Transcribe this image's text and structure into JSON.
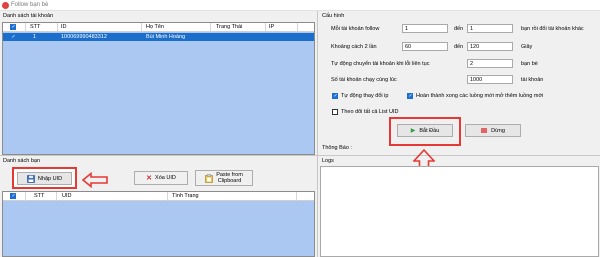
{
  "window": {
    "title": "Follow bạn bè"
  },
  "left_top": {
    "group_label": "Danh sách tài khoản",
    "columns": [
      "STT",
      "ID",
      "Họ Tên",
      "Trang Thái",
      "IP"
    ],
    "rows": [
      {
        "checked": true,
        "stt": "1",
        "id": "100069990483312",
        "name": "Bùi Minh Hoàng",
        "status": "",
        "ip": ""
      }
    ]
  },
  "config": {
    "group_label": "Cấu hình",
    "follow_per_account": {
      "label": "Mỗi tài khoản follow",
      "from": "1",
      "den": "đến",
      "to": "1",
      "suffix": "bạn rồi đổi tài khoản khác"
    },
    "interval": {
      "label": "Khoảng cách 2 lần",
      "from": "60",
      "den": "đến",
      "to": "120",
      "suffix": "Giây"
    },
    "auto_switch": {
      "label": "Tự động chuyển tài khoản khi lỗi liên tục",
      "value": "2",
      "suffix": "bạn bè"
    },
    "concurrent": {
      "label": "Số tài khoản chạy cùng lúc",
      "value": "1000",
      "suffix": "tài khoản"
    },
    "auto_ip": {
      "label": "Tự động thay đổi ip",
      "checked": true
    },
    "complete_new": {
      "label": "Hoàn thành xong các luồng mới mở thêm luồng mới",
      "checked": true
    },
    "follow_list": {
      "label": "Theo dõi  tất cả List UID",
      "checked": false
    }
  },
  "actions": {
    "start": "Bắt Đầu",
    "stop": "Dừng"
  },
  "notice": {
    "label": "Thông Báo :"
  },
  "logs": {
    "label": "Logs"
  },
  "left_bottom": {
    "group_label": "Danh sách bạn",
    "import_uid": "Nhập UID",
    "delete_uid": "Xóa UID",
    "paste_line1": "Paste from",
    "paste_line2": "Clipboard",
    "columns": [
      "STT",
      "UID",
      "Tình Trạng"
    ]
  },
  "colors": {
    "accent": "#1b6ec9",
    "highlight": "#e53935",
    "list_bg": "#aac8f2"
  }
}
